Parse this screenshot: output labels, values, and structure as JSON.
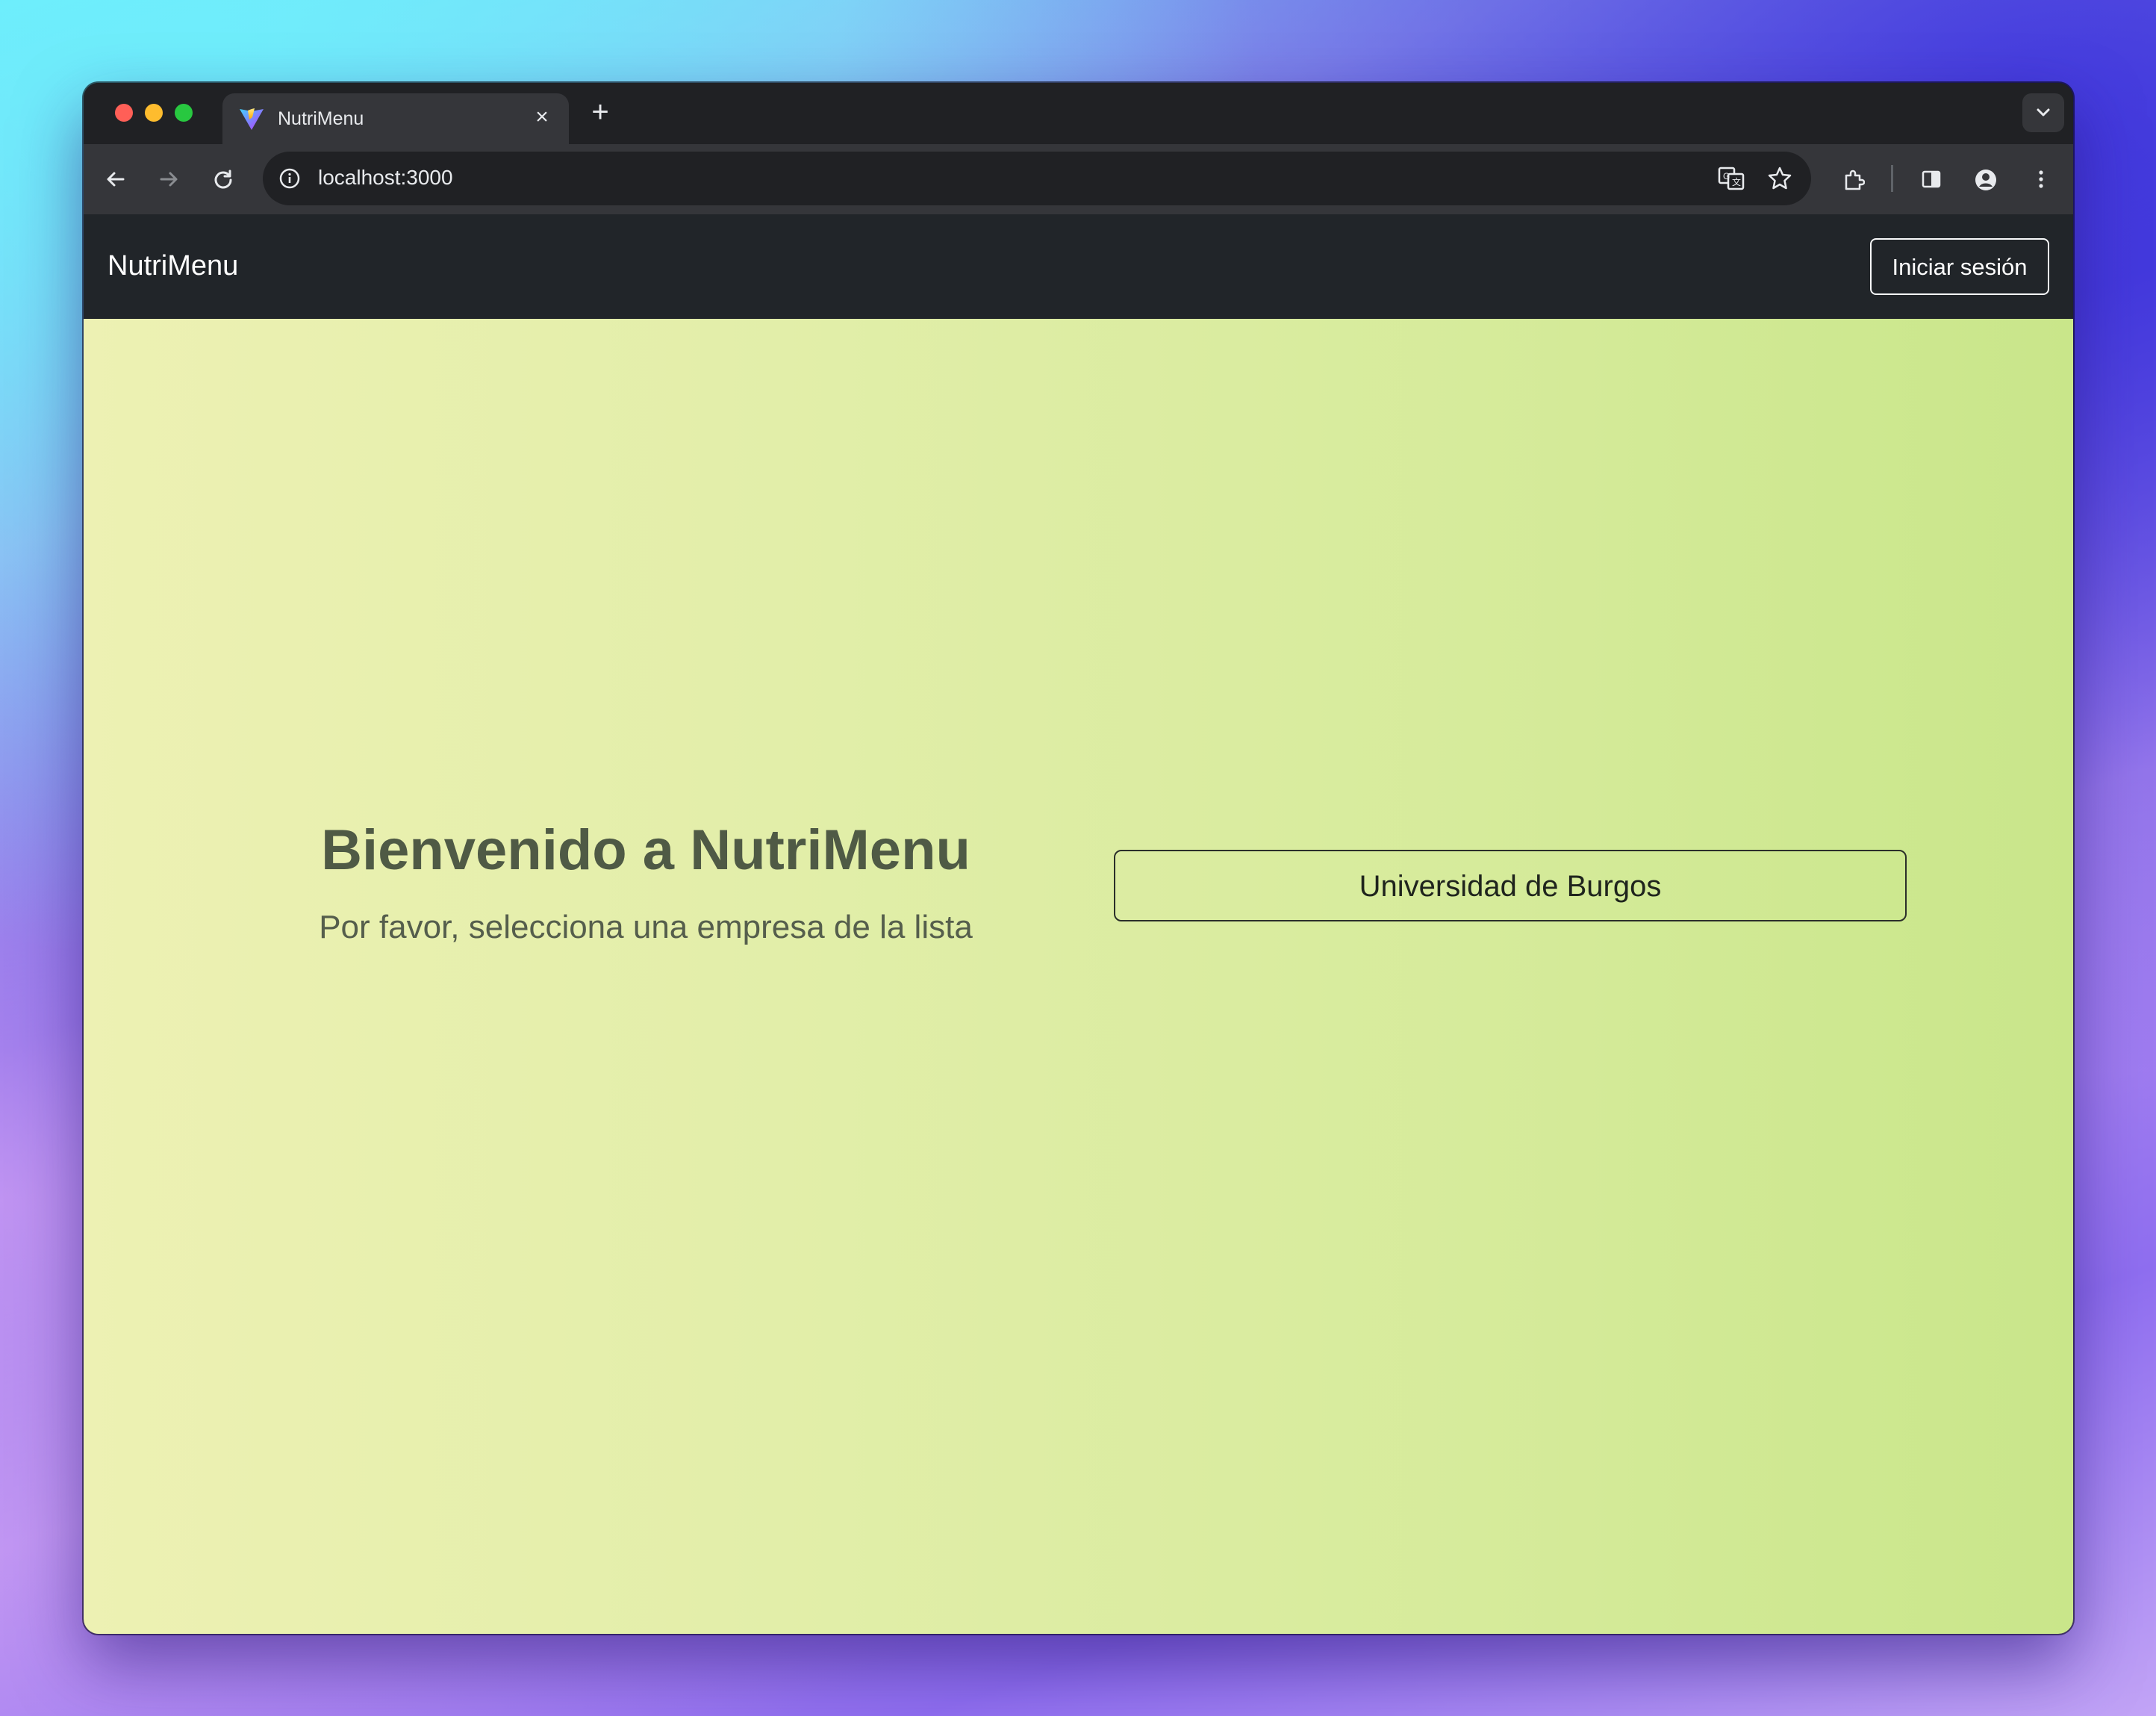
{
  "browser": {
    "tab": {
      "title": "NutriMenu",
      "close_glyph": "×"
    },
    "new_tab_glyph": "+",
    "address_bar": {
      "url": "localhost:3000"
    },
    "icons": [
      "back-icon",
      "forward-icon",
      "reload-icon",
      "info-icon",
      "translate-icon",
      "star-icon",
      "extensions-icon",
      "side-panel-icon",
      "profile-icon",
      "menu-icon",
      "tab-search-icon"
    ]
  },
  "navbar": {
    "brand": "NutriMenu",
    "login_label": "Iniciar sesión"
  },
  "main": {
    "title": "Bienvenido a NutriMenu",
    "subtitle": "Por favor, selecciona una empresa de la lista",
    "companies": [
      "Universidad de Burgos"
    ]
  },
  "colors": {
    "navbar_bg": "#212529",
    "content_gradient_start": "#edf1b3",
    "content_gradient_end": "#c9e68a",
    "title_color": "#4f5a45"
  }
}
